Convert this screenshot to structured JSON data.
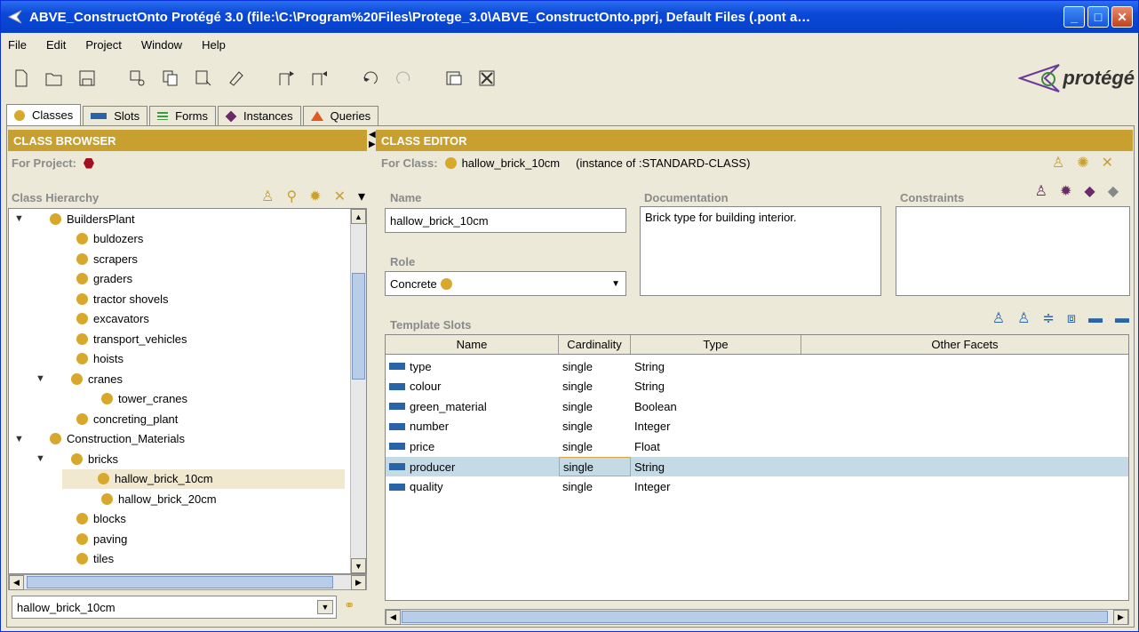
{
  "window": {
    "title": "ABVE_ConstructOnto  Protégé 3.0     (file:\\C:\\Program%20Files\\Protege_3.0\\ABVE_ConstructOnto.pprj, Default Files (.pont a…"
  },
  "menu": [
    "File",
    "Edit",
    "Project",
    "Window",
    "Help"
  ],
  "toolbar": {
    "icons": [
      "new-project-icon",
      "open-project-icon",
      "save-project-icon",
      "cut-icon",
      "copy-icon",
      "paste-icon",
      "clear-icon",
      "insert-before-icon",
      "insert-after-icon",
      "undo-icon",
      "redo-icon",
      "configure-icon",
      "close-icon"
    ]
  },
  "logo": "protégé",
  "tabs": [
    {
      "label": "Classes",
      "color": "#d7a82c"
    },
    {
      "label": "Slots",
      "color": "#2a64a8"
    },
    {
      "label": "Forms",
      "color": "#3e9c3e"
    },
    {
      "label": "Instances",
      "color": "#6a2a6a"
    },
    {
      "label": "Queries",
      "color": "#e05a20"
    }
  ],
  "browser": {
    "header": "CLASS BROWSER",
    "for_project": "For Project:",
    "hierarchy_label": "Class Hierarchy",
    "tree": [
      {
        "label": "BuildersPlant",
        "level": 0,
        "expanded": true
      },
      {
        "label": "buldozers",
        "level": 1
      },
      {
        "label": "scrapers",
        "level": 1
      },
      {
        "label": "graders",
        "level": 1
      },
      {
        "label": "tractor shovels",
        "level": 1
      },
      {
        "label": "excavators",
        "level": 1
      },
      {
        "label": "transport_vehicles",
        "level": 1
      },
      {
        "label": "hoists",
        "level": 1
      },
      {
        "label": "cranes",
        "level": 1,
        "expanded": true
      },
      {
        "label": "tower_cranes",
        "level": 2
      },
      {
        "label": "concreting_plant",
        "level": 1
      },
      {
        "label": "Construction_Materials",
        "level": 0,
        "expanded": true
      },
      {
        "label": "bricks",
        "level": 1,
        "expanded": true
      },
      {
        "label": "hallow_brick_10cm",
        "level": 2,
        "selected": true
      },
      {
        "label": "hallow_brick_20cm",
        "level": 2
      },
      {
        "label": "blocks",
        "level": 1
      },
      {
        "label": "paving",
        "level": 1
      },
      {
        "label": "tiles",
        "level": 1
      }
    ],
    "search_value": "hallow_brick_10cm"
  },
  "editor": {
    "header": "CLASS EDITOR",
    "for_class_label": "For Class:",
    "class_name": "hallow_brick_10cm",
    "instance_of": "(instance of :STANDARD-CLASS)",
    "name_label": "Name",
    "name_value": "hallow_brick_10cm",
    "documentation_label": "Documentation",
    "documentation_value": "Brick type for building interior.",
    "constraints_label": "Constraints",
    "role_label": "Role",
    "role_value": "Concrete",
    "template_slots_label": "Template Slots",
    "columns": [
      "Name",
      "Cardinality",
      "Type",
      "Other Facets"
    ],
    "slots": [
      {
        "name": "type",
        "cardinality": "single",
        "type": "String"
      },
      {
        "name": "colour",
        "cardinality": "single",
        "type": "String"
      },
      {
        "name": "green_material",
        "cardinality": "single",
        "type": "Boolean"
      },
      {
        "name": "number",
        "cardinality": "single",
        "type": "Integer"
      },
      {
        "name": "price",
        "cardinality": "single",
        "type": "Float"
      },
      {
        "name": "producer",
        "cardinality": "single",
        "type": "String",
        "selected": true
      },
      {
        "name": "quality",
        "cardinality": "single",
        "type": "Integer"
      }
    ]
  }
}
